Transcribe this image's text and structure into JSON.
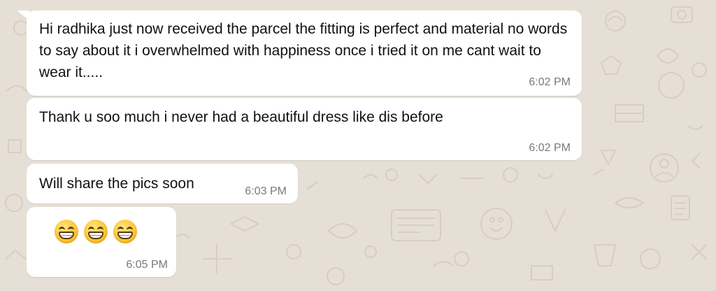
{
  "chat": {
    "messages": [
      {
        "text": "Hi radhika just now received the parcel the fitting is perfect and material no words to say about it i overwhelmed with happiness once i tried it on me cant wait to wear it.....",
        "time": "6:02 PM"
      },
      {
        "text": "Thank u soo much i never had a beautiful dress like dis before",
        "time": "6:02 PM"
      },
      {
        "text": "Will share the pics soon",
        "time": "6:03 PM"
      },
      {
        "emojis": [
          "grinning-face-with-smiling-eyes",
          "grinning-face-with-smiling-eyes",
          "grinning-face-with-smiling-eyes"
        ],
        "time": "6:05 PM"
      }
    ]
  },
  "theme": {
    "wallpaper": "#e6dfd6",
    "bubble": "#ffffff",
    "text": "#111111",
    "timestamp": "#7a7a7a"
  }
}
